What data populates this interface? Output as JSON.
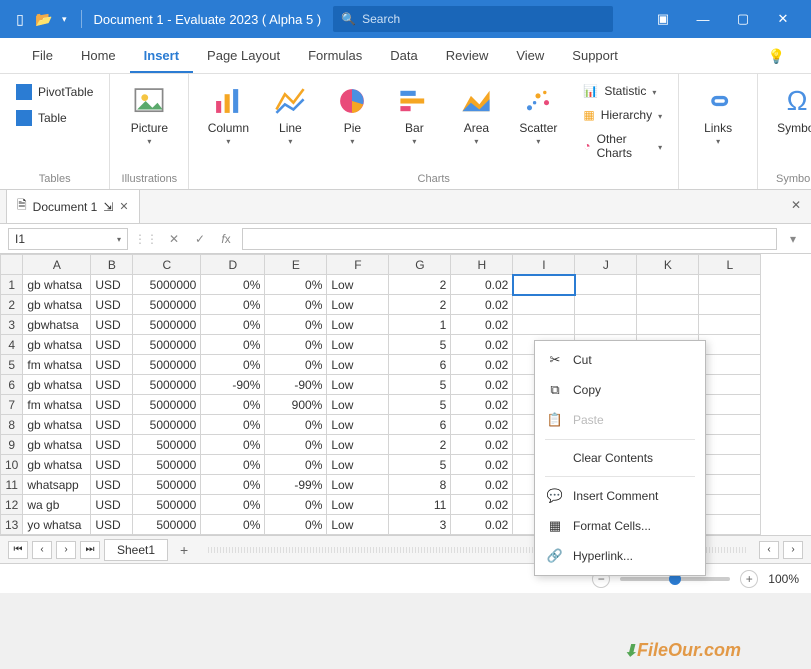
{
  "titlebar": {
    "doc_title": "Document 1 - Evaluate 2023 ( Alpha 5 )",
    "search_placeholder": "Search"
  },
  "ribbon_tabs": [
    "File",
    "Home",
    "Insert",
    "Page Layout",
    "Formulas",
    "Data",
    "Review",
    "View",
    "Support"
  ],
  "ribbon": {
    "tables": {
      "pivot": "PivotTable",
      "table": "Table",
      "group": "Tables"
    },
    "illustrations": {
      "picture": "Picture",
      "group": "Illustrations"
    },
    "charts": {
      "column": "Column",
      "line": "Line",
      "pie": "Pie",
      "bar": "Bar",
      "area": "Area",
      "scatter": "Scatter",
      "statistic": "Statistic",
      "hierarchy": "Hierarchy",
      "other": "Other Charts",
      "group": "Charts"
    },
    "links": {
      "links": "Links"
    },
    "symbols": {
      "symbol": "Symbol",
      "group": "Symbols"
    }
  },
  "doctab": "Document 1",
  "namebox": "I1",
  "columns": [
    "A",
    "B",
    "C",
    "D",
    "E",
    "F",
    "G",
    "H",
    "I",
    "J",
    "K",
    "L"
  ],
  "rows": [
    {
      "n": 1,
      "a": "gb whatsa",
      "b": "USD",
      "c": "5000000",
      "d": "0%",
      "e": "0%",
      "f": "Low",
      "g": "2",
      "h": "0.02"
    },
    {
      "n": 2,
      "a": "gb whatsa",
      "b": "USD",
      "c": "5000000",
      "d": "0%",
      "e": "0%",
      "f": "Low",
      "g": "2",
      "h": "0.02"
    },
    {
      "n": 3,
      "a": "gbwhatsa",
      "b": "USD",
      "c": "5000000",
      "d": "0%",
      "e": "0%",
      "f": "Low",
      "g": "1",
      "h": "0.02"
    },
    {
      "n": 4,
      "a": "gb whatsa",
      "b": "USD",
      "c": "5000000",
      "d": "0%",
      "e": "0%",
      "f": "Low",
      "g": "5",
      "h": "0.02"
    },
    {
      "n": 5,
      "a": "fm whatsa",
      "b": "USD",
      "c": "5000000",
      "d": "0%",
      "e": "0%",
      "f": "Low",
      "g": "6",
      "h": "0.02"
    },
    {
      "n": 6,
      "a": "gb whatsa",
      "b": "USD",
      "c": "5000000",
      "d": "-90%",
      "e": "-90%",
      "f": "Low",
      "g": "5",
      "h": "0.02"
    },
    {
      "n": 7,
      "a": "fm whatsa",
      "b": "USD",
      "c": "5000000",
      "d": "0%",
      "e": "900%",
      "f": "Low",
      "g": "5",
      "h": "0.02"
    },
    {
      "n": 8,
      "a": "gb whatsa",
      "b": "USD",
      "c": "5000000",
      "d": "0%",
      "e": "0%",
      "f": "Low",
      "g": "6",
      "h": "0.02"
    },
    {
      "n": 9,
      "a": "gb whatsa",
      "b": "USD",
      "c": "500000",
      "d": "0%",
      "e": "0%",
      "f": "Low",
      "g": "2",
      "h": "0.02"
    },
    {
      "n": 10,
      "a": "gb whatsa",
      "b": "USD",
      "c": "500000",
      "d": "0%",
      "e": "0%",
      "f": "Low",
      "g": "5",
      "h": "0.02"
    },
    {
      "n": 11,
      "a": "whatsapp",
      "b": "USD",
      "c": "500000",
      "d": "0%",
      "e": "-99%",
      "f": "Low",
      "g": "8",
      "h": "0.02"
    },
    {
      "n": 12,
      "a": "wa gb",
      "b": "USD",
      "c": "500000",
      "d": "0%",
      "e": "0%",
      "f": "Low",
      "g": "11",
      "h": "0.02"
    },
    {
      "n": 13,
      "a": "yo whatsa",
      "b": "USD",
      "c": "500000",
      "d": "0%",
      "e": "0%",
      "f": "Low",
      "g": "3",
      "h": "0.02"
    }
  ],
  "context_menu": {
    "cut": "Cut",
    "copy": "Copy",
    "paste": "Paste",
    "clear": "Clear Contents",
    "insert_comment": "Insert Comment",
    "format_cells": "Format Cells...",
    "hyperlink": "Hyperlink..."
  },
  "sheet": "Sheet1",
  "zoom": "100%",
  "watermark": "FileOur.com"
}
